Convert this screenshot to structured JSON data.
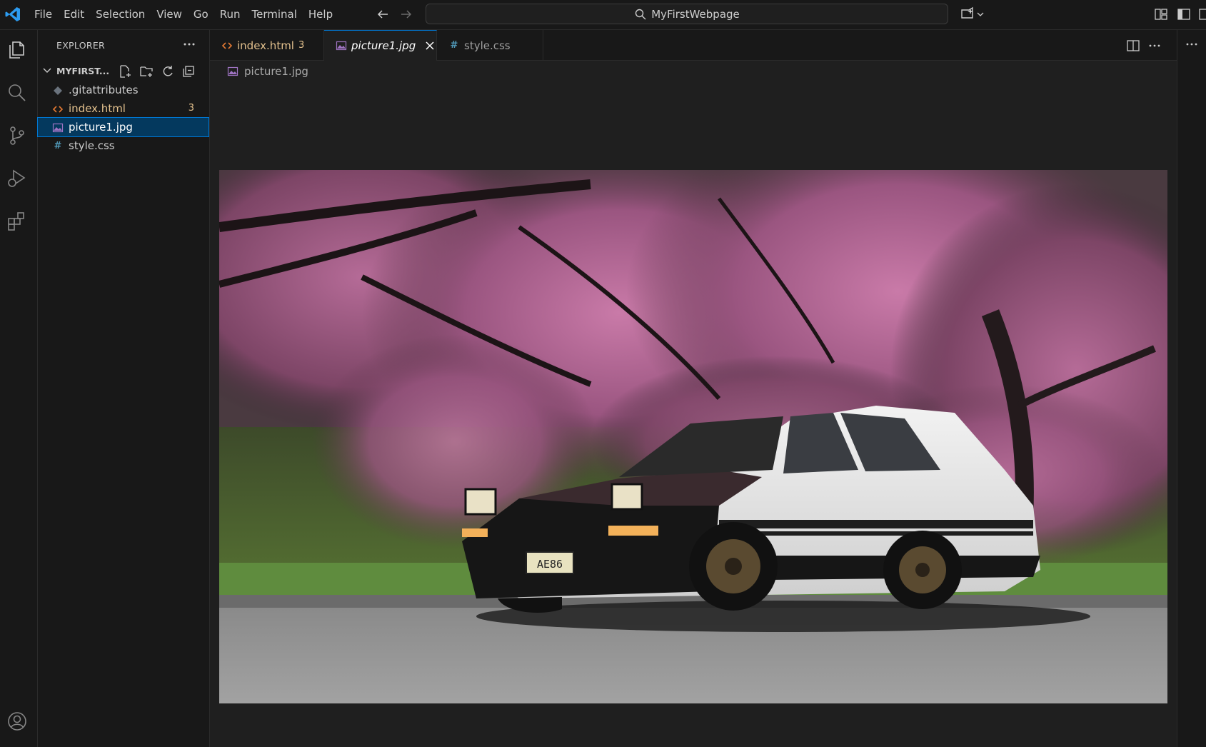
{
  "menu": [
    "File",
    "Edit",
    "Selection",
    "View",
    "Go",
    "Run",
    "Terminal",
    "Help"
  ],
  "command_center": {
    "text": "MyFirstWebpage",
    "icon": "search-icon"
  },
  "sidebar": {
    "title": "EXPLORER",
    "folder": "MYFIRST...",
    "files": [
      {
        "name": ".gitattributes",
        "icon": "git-file-icon",
        "badge": ""
      },
      {
        "name": "index.html",
        "icon": "html-file-icon",
        "badge": "3"
      },
      {
        "name": "picture1.jpg",
        "icon": "image-file-icon",
        "badge": ""
      },
      {
        "name": "style.css",
        "icon": "css-file-icon",
        "badge": ""
      }
    ]
  },
  "tabs": [
    {
      "label": "index.html",
      "badge": "3",
      "icon": "html-file-icon"
    },
    {
      "label": "picture1.jpg",
      "icon": "image-file-icon",
      "active": true
    },
    {
      "label": "style.css",
      "icon": "css-file-icon"
    }
  ],
  "breadcrumb": {
    "file": "picture1.jpg"
  },
  "colors": {
    "accent": "#0078d4",
    "selection": "#04395e",
    "modified": "#e2c08d",
    "html_icon": "#e37933",
    "css_icon": "#519aba",
    "image_icon": "#a074c4"
  }
}
